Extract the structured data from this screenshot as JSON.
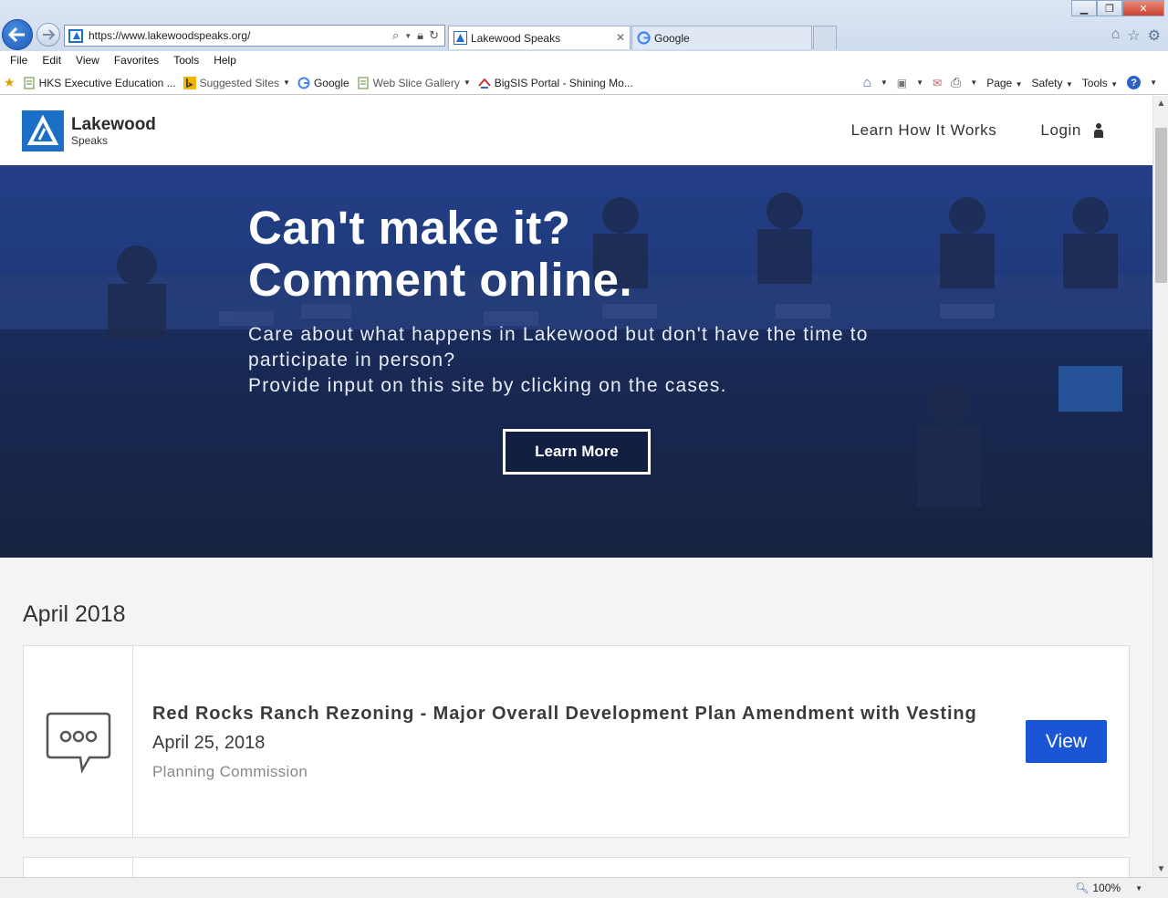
{
  "browser": {
    "url": "https://www.lakewoodspeaks.org/",
    "tabs": [
      {
        "label": "Lakewood Speaks",
        "active": true
      },
      {
        "label": "Google",
        "active": false
      }
    ],
    "menu": [
      "File",
      "Edit",
      "View",
      "Favorites",
      "Tools",
      "Help"
    ],
    "favorites": [
      {
        "label": "HKS Executive Education ...",
        "icon": "page-icon"
      },
      {
        "label": "Suggested Sites",
        "icon": "bing-icon",
        "dropdown": true
      },
      {
        "label": "Google",
        "icon": "google-icon"
      },
      {
        "label": "Web Slice Gallery",
        "icon": "page-icon",
        "dropdown": true
      },
      {
        "label": "BigSIS Portal - Shining Mo...",
        "icon": "bigsis-icon"
      }
    ],
    "command_bar": [
      "Page",
      "Safety",
      "Tools"
    ],
    "zoom": "100%"
  },
  "site": {
    "logo": {
      "name": "Lakewood",
      "tagline": "Speaks"
    },
    "nav": {
      "learn": "Learn How It Works",
      "login": "Login"
    },
    "hero": {
      "title_line1": "Can't make it?",
      "title_line2": "Comment online.",
      "subtitle_line1": "Care about what happens in Lakewood but don't have the time to",
      "subtitle_line2": "participate in person?",
      "subtitle_line3": "Provide input on this site by clicking on the cases.",
      "button": "Learn More"
    },
    "month": "April 2018",
    "cases": [
      {
        "title": "Red Rocks Ranch Rezoning - Major Overall Development Plan Amendment with Vesting",
        "date": "April 25, 2018",
        "body": "Planning Commission",
        "button": "View"
      }
    ]
  },
  "colors": {
    "brand_blue": "#1b6fc6",
    "view_button": "#1a55d6",
    "hero_overlay": "#1e3a7c"
  }
}
